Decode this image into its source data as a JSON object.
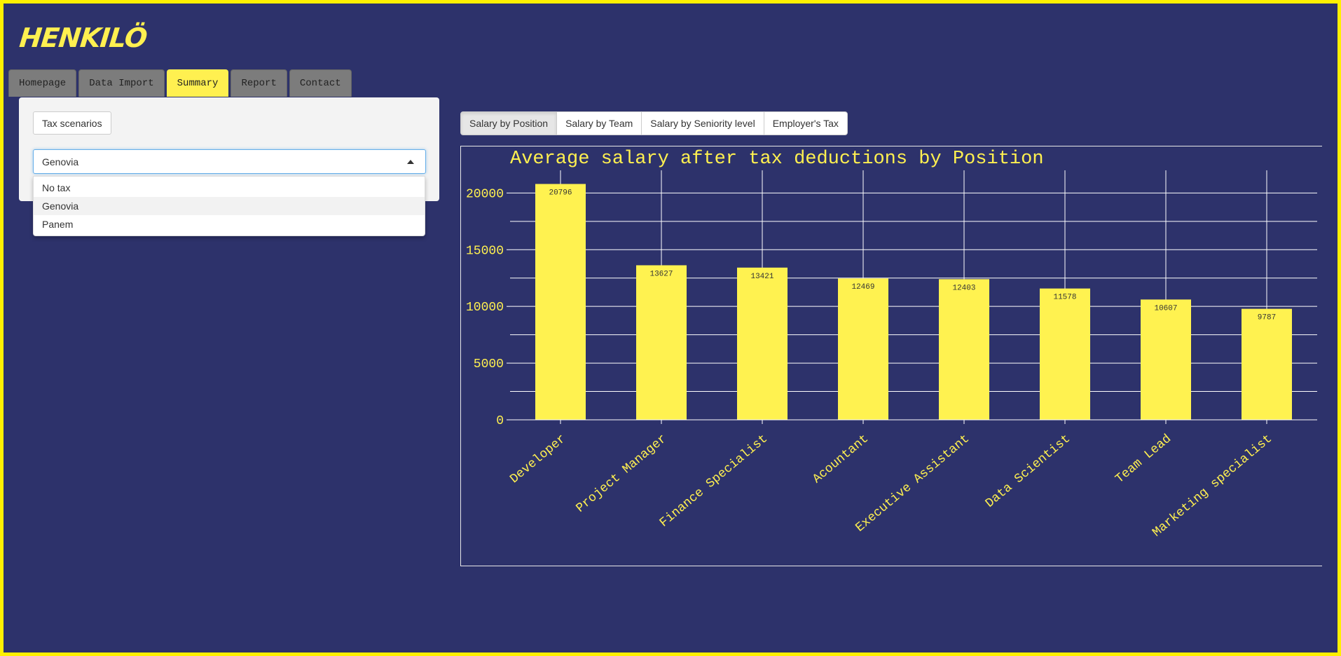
{
  "app": {
    "logo": "HENKILÖ"
  },
  "nav": {
    "tabs": [
      {
        "label": "Homepage"
      },
      {
        "label": "Data Import"
      },
      {
        "label": "Summary",
        "active": true
      },
      {
        "label": "Report"
      },
      {
        "label": "Contact"
      }
    ]
  },
  "panel": {
    "tax_button": "Tax scenarios",
    "select": {
      "value": "Genovia",
      "options": [
        "No tax",
        "Genovia",
        "Panem"
      ],
      "highlighted": "Genovia"
    }
  },
  "chart_tabs": [
    {
      "label": "Salary by Position",
      "active": true
    },
    {
      "label": "Salary by Team"
    },
    {
      "label": "Salary by Seniority level"
    },
    {
      "label": "Employer's Tax"
    }
  ],
  "colors": {
    "background": "#2d326b",
    "accent": "#fff050",
    "bar": "#fff250",
    "grid": "#ffffff"
  },
  "chart_data": {
    "type": "bar",
    "title": "Average salary after tax deductions by Position",
    "xlabel": "",
    "ylabel": "",
    "categories": [
      "Developer",
      "Project Manager",
      "Finance Specialist",
      "Acountant",
      "Executive Assistant",
      "Data Scientist",
      "Team Lead",
      "Marketing specialist"
    ],
    "values": [
      20796,
      13627,
      13421,
      12469,
      12403,
      11578,
      10607,
      9787
    ],
    "ylim": [
      0,
      22000
    ],
    "yticks": [
      0,
      5000,
      10000,
      15000,
      20000
    ],
    "grid": true,
    "legend": "none"
  }
}
